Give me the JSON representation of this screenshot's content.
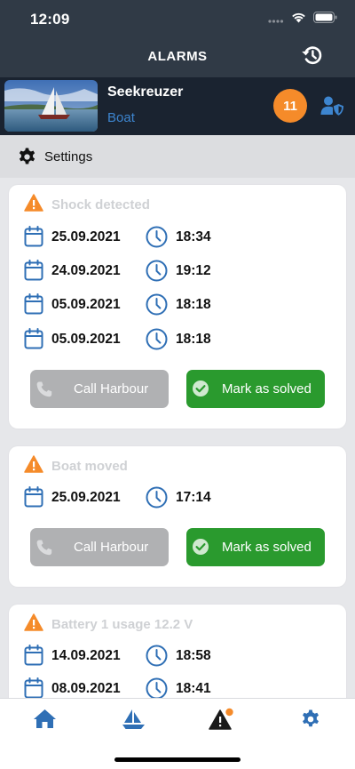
{
  "status_bar": {
    "time": "12:09"
  },
  "header": {
    "title": "ALARMS"
  },
  "boat": {
    "name": "Seekreuzer",
    "type": "Boat",
    "alarm_count": "11"
  },
  "settings": {
    "label": "Settings"
  },
  "alarm_groups": [
    {
      "title": "Shock detected",
      "entries": [
        {
          "date": "25.09.2021",
          "time": "18:34"
        },
        {
          "date": "24.09.2021",
          "time": "19:12"
        },
        {
          "date": "05.09.2021",
          "time": "18:18"
        },
        {
          "date": "05.09.2021",
          "time": "18:18"
        }
      ],
      "call_label": "Call Harbour",
      "solve_label": "Mark as solved"
    },
    {
      "title": "Boat moved",
      "entries": [
        {
          "date": "25.09.2021",
          "time": "17:14"
        }
      ],
      "call_label": "Call Harbour",
      "solve_label": "Mark as solved"
    },
    {
      "title": "Battery 1 usage 12.2 V",
      "entries": [
        {
          "date": "14.09.2021",
          "time": "18:58"
        },
        {
          "date": "08.09.2021",
          "time": "18:41"
        }
      ]
    }
  ],
  "bottom_nav": [
    "home-icon",
    "boat-icon",
    "alarms-icon",
    "settings-icon"
  ],
  "colors": {
    "header_bg": "#303a46",
    "boat_bar_bg": "#1a2330",
    "accent_blue": "#2f6fb5",
    "badge_orange": "#f58b2a",
    "solve_green": "#2a9a2e",
    "call_gray": "#b0b1b3"
  }
}
